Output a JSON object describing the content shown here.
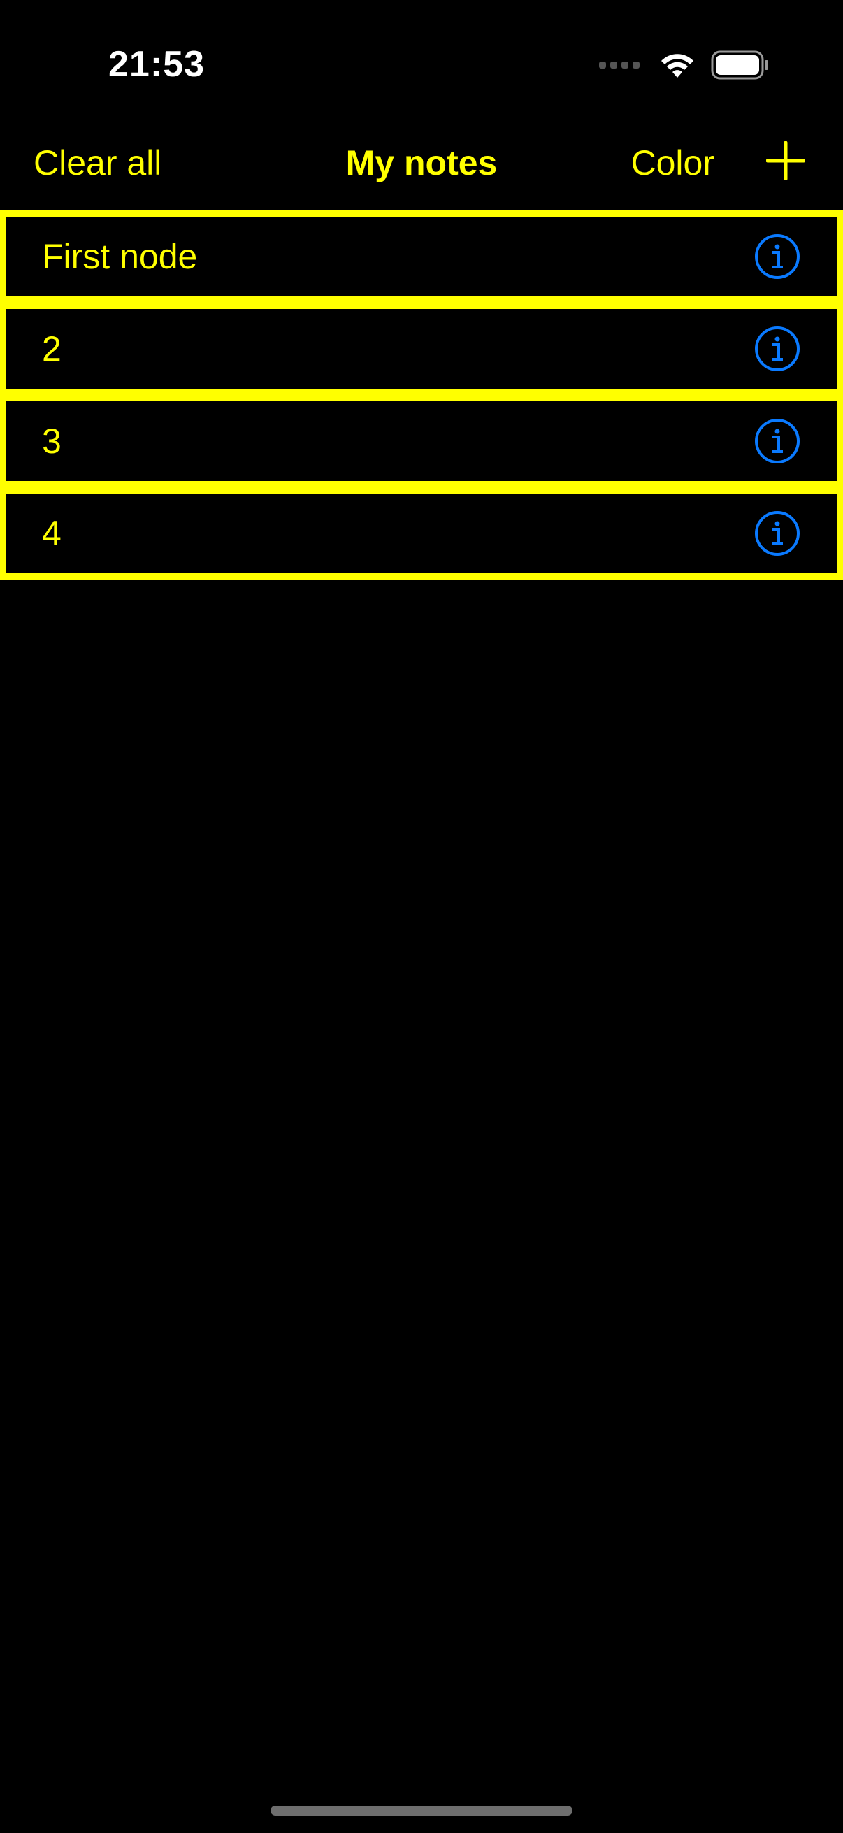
{
  "status_bar": {
    "time": "21:53"
  },
  "nav": {
    "left_action": "Clear all",
    "title": "My notes",
    "color_action": "Color",
    "add_icon": "plus-icon"
  },
  "notes": [
    {
      "label": "First node",
      "icon": "info-circle-icon"
    },
    {
      "label": "2",
      "icon": "info-circle-icon"
    },
    {
      "label": "3",
      "icon": "info-circle-icon"
    },
    {
      "label": "4",
      "icon": "info-circle-icon"
    }
  ],
  "colors": {
    "accent": "#ffff00",
    "info": "#0a7aff",
    "background": "#000000"
  }
}
